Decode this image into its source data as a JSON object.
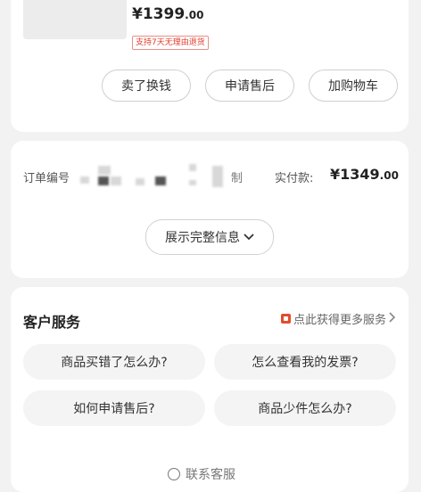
{
  "product": {
    "price_main": "¥1399",
    "price_cents": ".00",
    "service_tag": "支持7天无理由退货",
    "buttons": {
      "resell": "卖了换钱",
      "after_sale": "申请售后",
      "add_to_cart": "加购物车"
    }
  },
  "order": {
    "number_label": "订单编号",
    "number_tail": "制",
    "paid_label": "实付款:",
    "paid_main": "¥1349",
    "paid_cents": ".00",
    "expand_label": "展示完整信息",
    "expand_icon": "chevron-down-icon"
  },
  "service": {
    "title": "客户服务",
    "more_link": "点此获得更多服务",
    "questions": [
      "商品买错了怎么办?",
      "怎么查看我的发票?",
      "如何申请售后?",
      "商品少件怎么办?"
    ],
    "contact_label": "联系客服",
    "accent_color": "#e34d2e"
  }
}
